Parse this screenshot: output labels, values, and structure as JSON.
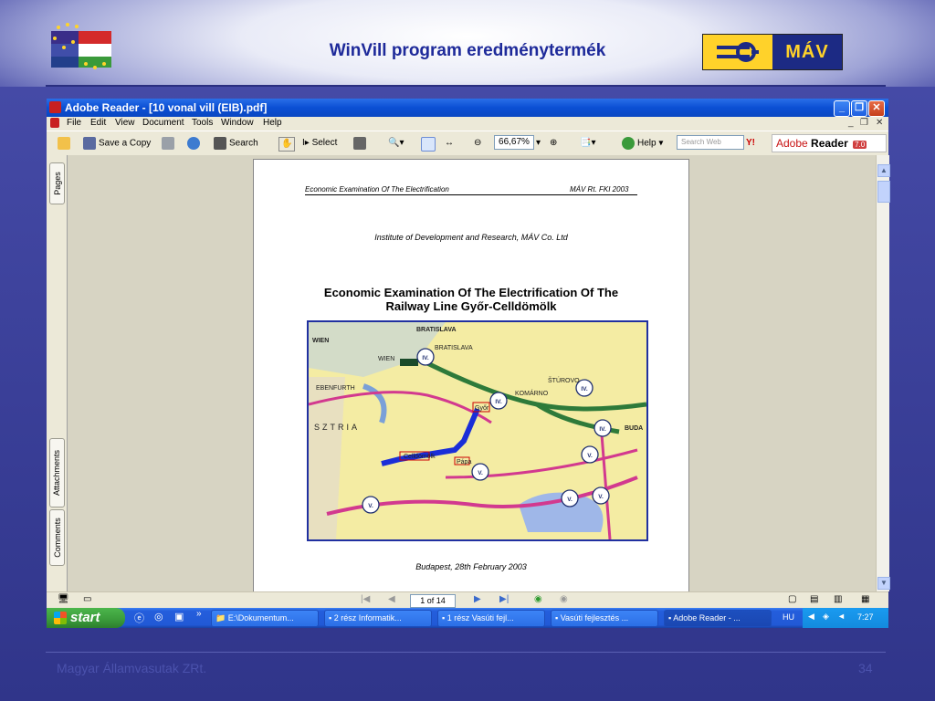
{
  "slide": {
    "title": "WinVill program eredménytermék",
    "logo_text": "MÁV",
    "footer_left": "Magyar Államvasutak ZRt.",
    "footer_right": "34"
  },
  "window": {
    "title": "Adobe Reader - [10 vonal vill (EIB).pdf]",
    "menu": [
      "File",
      "Edit",
      "View",
      "Document",
      "Tools",
      "Window",
      "Help"
    ],
    "toolbar": {
      "save_copy": "Save a Copy",
      "search": "Search",
      "select": "Select",
      "zoom": "66,67%",
      "help": "Help",
      "search_web_placeholder": "Search Web",
      "brand": "Adobe",
      "brand_reader": "Reader",
      "brand_version": "7.0"
    },
    "side_tabs": [
      "Pages",
      "Attachments",
      "Comments"
    ]
  },
  "document": {
    "header_left": "Economic Examination Of The Electrification",
    "header_right": "MÁV Rt. FKI 2003",
    "institute": "Institute of Development and Research, MÁV Co. Ltd",
    "title_line1": "Economic Examination Of The Electrification Of The",
    "title_line2": "Railway Line Győr-Celldömölk",
    "date_line": "Budapest, 28th February 2003",
    "map_labels": [
      "BRATISLAVA",
      "WIEN",
      "WIEN",
      "BRATISLAVA",
      "ŠTÚROVO",
      "KOMÁRNO",
      "EBENFURTH",
      "SZTRIA",
      "BUDA",
      "Győr",
      "Pápa",
      "Celldömölk",
      "IV.",
      "IV.",
      "IV.",
      "IV.",
      "V.",
      "V.",
      "V.",
      "V.",
      "V.",
      "V."
    ]
  },
  "statusbar": {
    "page_indicator": "1 of 14"
  },
  "taskbar": {
    "start": "start",
    "tasks": [
      "E:\\Dokumentum...",
      "2 rész Informatik...",
      "1 rész Vasúti fejl...",
      "Vasúti fejlesztés ...",
      "Adobe Reader - ..."
    ],
    "lang": "HU",
    "time": "7:27"
  }
}
